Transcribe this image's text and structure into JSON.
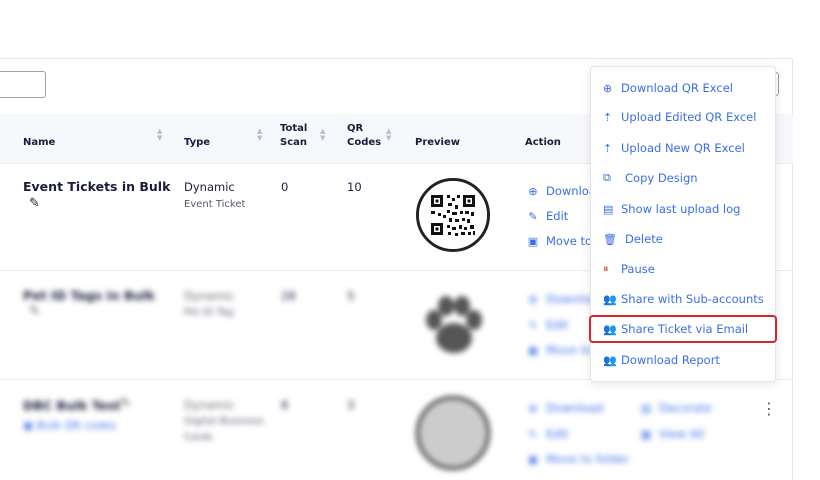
{
  "table": {
    "headers": {
      "name": "Name",
      "type": "Type",
      "total_scan_1": "Total",
      "total_scan_2": "Scan",
      "qr_codes_1": "QR",
      "qr_codes_2": "Codes",
      "preview": "Preview",
      "action": "Action"
    },
    "rows": [
      {
        "name": "Event Tickets in Bulk",
        "type": "Dynamic",
        "subtype": "Event Ticket",
        "total_scan": "0",
        "qr_codes": "10",
        "actions": [
          "Download",
          "Edit",
          "Move to"
        ]
      },
      {
        "name": "Pet ID Tags in Bulk",
        "type": "Dynamic",
        "subtype": "Pet ID Tag",
        "total_scan": "28",
        "qr_codes": "5",
        "actions": [
          "Download",
          "Edit",
          "Move to"
        ]
      },
      {
        "name": "DBC Bulk Test",
        "folder_link": "Bulk QR codes",
        "type": "Dynamic",
        "subtype": "Digital Business Cards",
        "total_scan": "8",
        "qr_codes": "3",
        "actions": [
          "Download",
          "Edit",
          "Move to folder"
        ],
        "actions_right": [
          "Decorate",
          "View All"
        ]
      }
    ]
  },
  "menu": {
    "items": [
      {
        "label": "Download QR Excel",
        "icon": "download-circle-icon"
      },
      {
        "label": "Upload Edited QR Excel",
        "icon": "upload-icon"
      },
      {
        "label": "Upload New QR Excel",
        "icon": "upload-icon"
      },
      {
        "label": "Copy Design",
        "icon": "copy-icon"
      },
      {
        "label": "Show last upload log",
        "icon": "document-icon"
      },
      {
        "label": "Delete",
        "icon": "trash-icon"
      },
      {
        "label": "Pause",
        "icon": "pause-icon"
      },
      {
        "label": "Share with Sub-accounts",
        "icon": "users-icon"
      },
      {
        "label": "Share Ticket via Email",
        "icon": "users-icon"
      },
      {
        "label": "Download Report",
        "icon": "users-icon"
      }
    ],
    "highlighted": "Share Ticket via Email"
  },
  "colors": {
    "accent": "#3a6ee8",
    "highlight_border": "#d7262a",
    "header_bg": "#f7f8fb",
    "text": "#1a1d3a"
  }
}
